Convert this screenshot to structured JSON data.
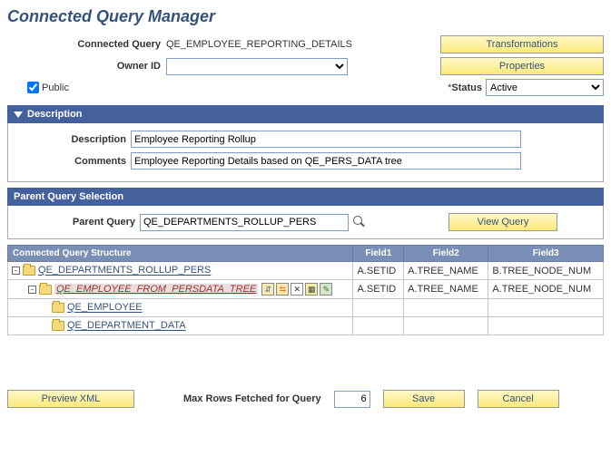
{
  "page_title": "Connected Query Manager",
  "header": {
    "connected_query_label": "Connected Query",
    "connected_query_value": "QE_EMPLOYEE_REPORTING_DETAILS",
    "owner_id_label": "Owner ID",
    "owner_id_value": "",
    "public_label": "Public",
    "status_label": "Status",
    "status_value": "Active",
    "transformations_btn": "Transformations",
    "properties_btn": "Properties"
  },
  "description_section": {
    "title": "Description",
    "description_label": "Description",
    "description_value": "Employee Reporting Rollup",
    "comments_label": "Comments",
    "comments_value": "Employee Reporting Details based on QE_PERS_DATA tree"
  },
  "parent_section": {
    "title": "Parent Query Selection",
    "parent_query_label": "Parent Query",
    "parent_query_value": "QE_DEPARTMENTS_ROLLUP_PERS",
    "view_query_btn": "View Query"
  },
  "structure": {
    "col_structure": "Connected Query Structure",
    "col_f1": "Field1",
    "col_f2": "Field2",
    "col_f3": "Field3",
    "rows": [
      {
        "expand": "-",
        "indent": 1,
        "selected": false,
        "label": "QE_DEPARTMENTS_ROLLUP_PERS",
        "tools": false,
        "f1": "A.SETID",
        "f2": "A.TREE_NAME",
        "f3": "B.TREE_NODE_NUM"
      },
      {
        "expand": "-",
        "indent": 2,
        "selected": true,
        "label": "QE_EMPLOYEE_FROM_PERSDATA_TREE",
        "tools": true,
        "f1": "A.SETID",
        "f2": "A.TREE_NAME",
        "f3": "A.TREE_NODE_NUM"
      },
      {
        "expand": "",
        "indent": 3,
        "selected": false,
        "label": "QE_EMPLOYEE",
        "tools": false,
        "f1": "",
        "f2": "",
        "f3": ""
      },
      {
        "expand": "",
        "indent": 3,
        "selected": false,
        "label": "QE_DEPARTMENT_DATA",
        "tools": false,
        "f1": "",
        "f2": "",
        "f3": ""
      }
    ]
  },
  "footer": {
    "preview_xml_btn": "Preview XML",
    "max_rows_label": "Max Rows Fetched for Query",
    "max_rows_value": "6",
    "save_btn": "Save",
    "cancel_btn": "Cancel"
  }
}
